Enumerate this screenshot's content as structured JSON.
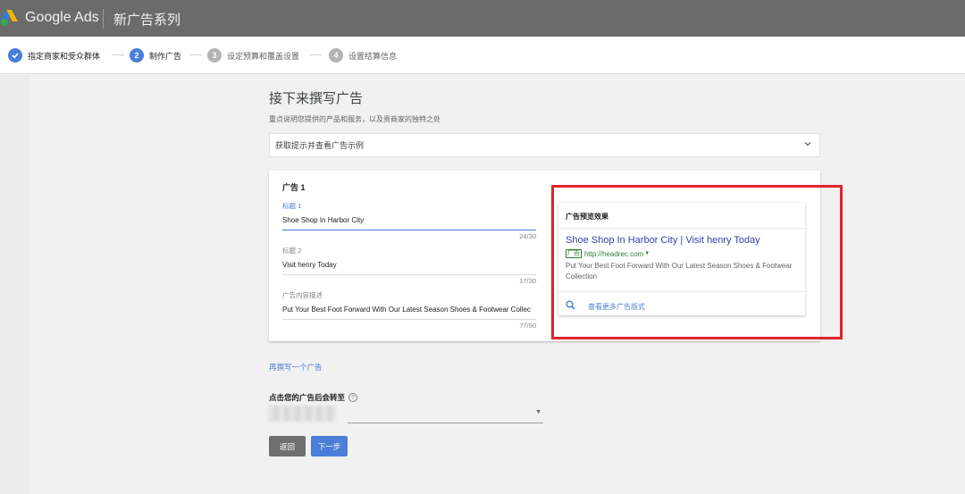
{
  "header": {
    "brand": "Google Ads",
    "campaign_title": "新广告系列"
  },
  "stepper": {
    "steps": [
      {
        "label": "指定商家和受众群体",
        "state": "done"
      },
      {
        "number": "2",
        "label": "制作广告",
        "state": "current"
      },
      {
        "number": "3",
        "label": "设定预算和覆盖设置",
        "state": "todo"
      },
      {
        "number": "4",
        "label": "设置结算信息",
        "state": "todo"
      }
    ]
  },
  "main": {
    "title": "接下来撰写广告",
    "subtitle": "重点说明您提供的产品和服务，以及贵商家的独特之处",
    "tips_label": "获取提示并查看广告示例"
  },
  "ad": {
    "title": "广告 1",
    "headline1": {
      "label": "标题 1",
      "value": "Shoe Shop In Harbor City",
      "count": "24/30"
    },
    "headline2": {
      "label": "标题 2",
      "value": "Visit henry Today",
      "count": "17/30"
    },
    "description": {
      "label": "广告内容描述",
      "value": "Put Your Best Foot Forward With Our Latest Season Shoes & Footwear Collec",
      "count": "77/90"
    }
  },
  "preview": {
    "header": "广告预览效果",
    "headline": "Shoe Shop In Harbor City | Visit henry Today",
    "badge": "广告",
    "url": "http://headrec.com",
    "description": "Put Your Best Foot Forward With Our Latest Season Shoes & Footwear Collection",
    "more_label": "查看更多广告版式"
  },
  "actions": {
    "write_another": "再撰写一个广告",
    "redirect_label": "点击您的广告后会转至",
    "back": "返回",
    "next": "下一步"
  },
  "colors": {
    "accent": "#4a7ed8",
    "topbar": "#6b6b6b",
    "highlight_frame": "#e0242b",
    "ad_green": "#2e7d32"
  }
}
